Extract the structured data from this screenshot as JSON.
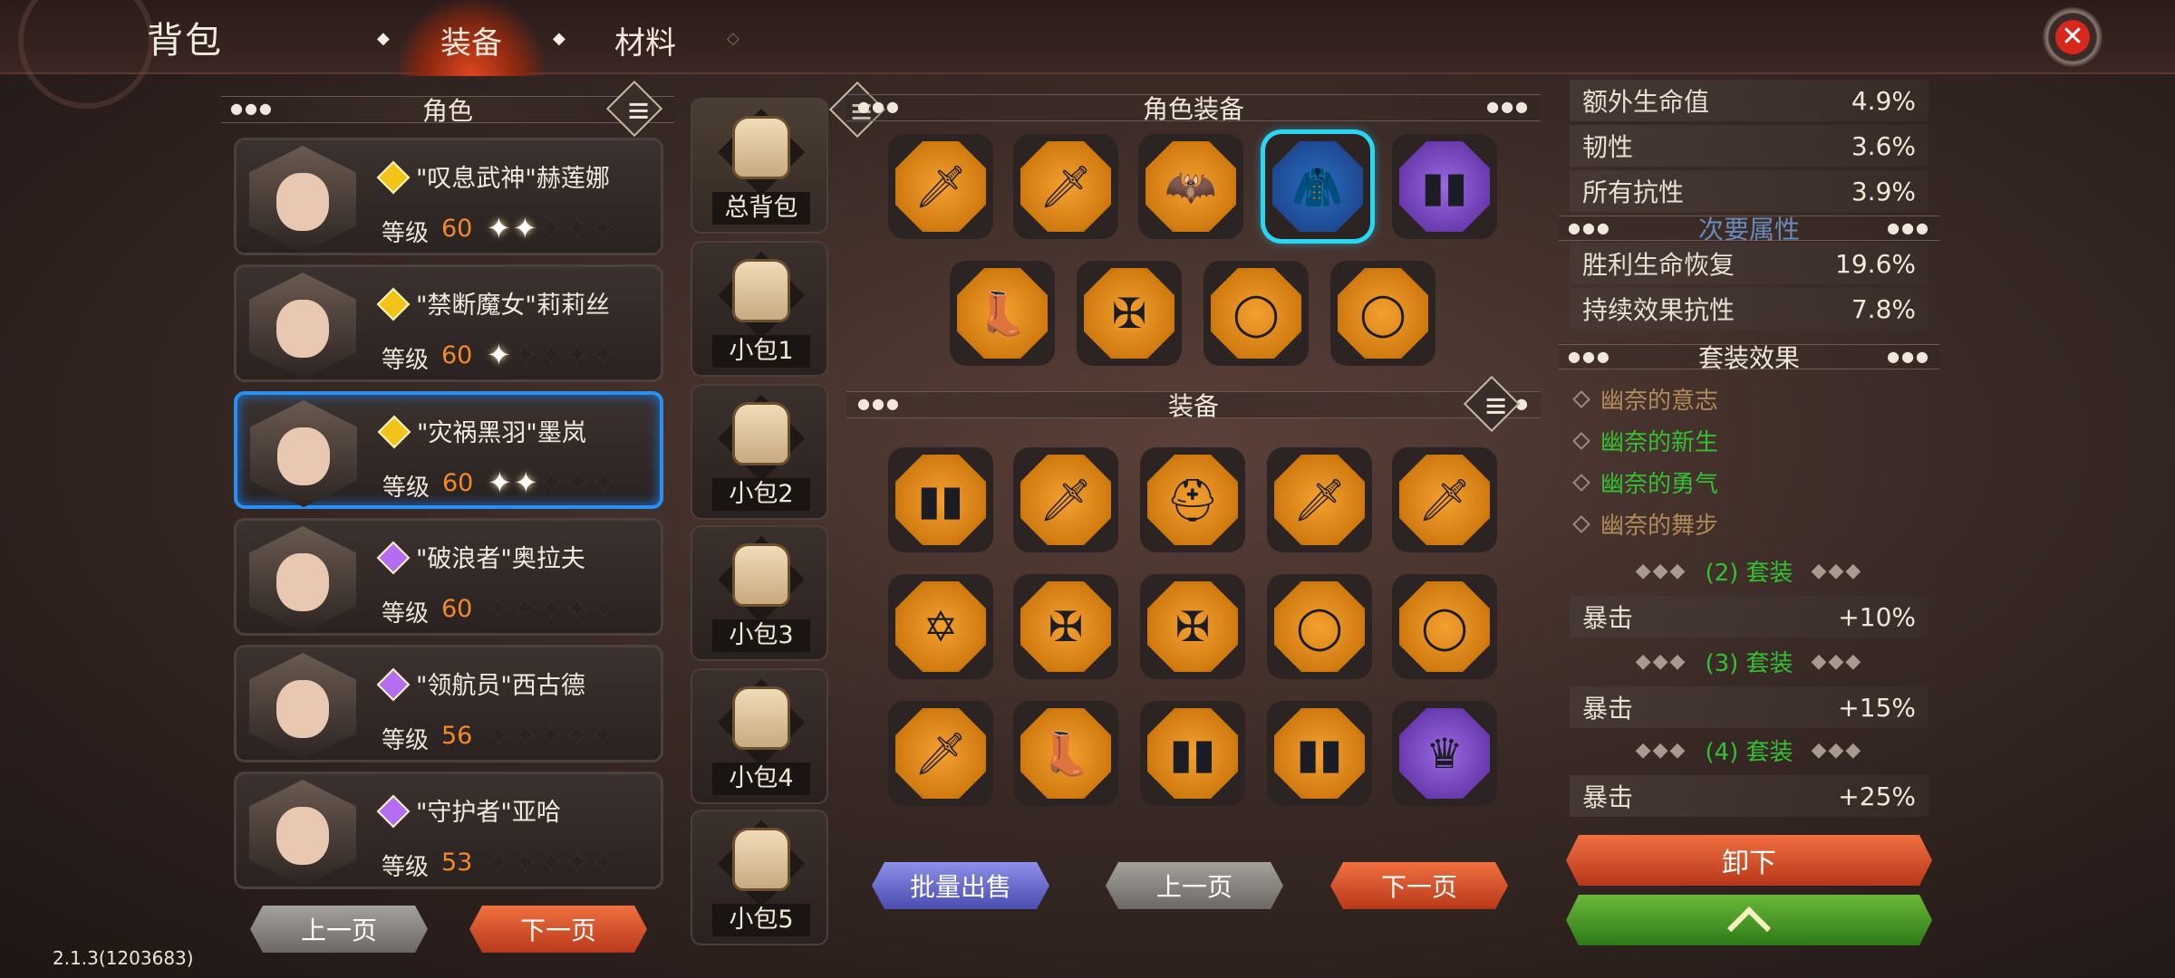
{
  "header": {
    "title": "背包",
    "tabs": [
      {
        "label": "装备",
        "active": true
      },
      {
        "label": "材料",
        "active": false
      }
    ]
  },
  "heroes_section": {
    "title": "角色"
  },
  "heroes": [
    {
      "name": "\"叹息武神\"赫莲娜",
      "level_label": "等级",
      "level": "60",
      "stars": 2,
      "gem_color": "#f2c41a"
    },
    {
      "name": "\"禁断魔女\"莉莉丝",
      "level_label": "等级",
      "level": "60",
      "stars": 1,
      "gem_color": "#f2c41a"
    },
    {
      "name": "\"灾祸黑羽\"墨岚",
      "level_label": "等级",
      "level": "60",
      "stars": 2,
      "gem_color": "#f2c41a",
      "selected": true
    },
    {
      "name": "\"破浪者\"奥拉夫",
      "level_label": "等级",
      "level": "60",
      "stars": 0,
      "gem_color": "#b46cf0"
    },
    {
      "name": "\"领航员\"西古德",
      "level_label": "等级",
      "level": "56",
      "stars": 0,
      "gem_color": "#b46cf0"
    },
    {
      "name": "\"守护者\"亚哈",
      "level_label": "等级",
      "level": "53",
      "stars": 0,
      "gem_color": "#b46cf0"
    }
  ],
  "hero_pager": {
    "prev": "上一页",
    "next": "下一页"
  },
  "bags": [
    {
      "label": "总背包",
      "active": true
    },
    {
      "label": "小包1"
    },
    {
      "label": "小包2"
    },
    {
      "label": "小包3"
    },
    {
      "label": "小包4"
    },
    {
      "label": "小包5"
    }
  ],
  "character_equipment": {
    "title": "角色装备",
    "slots": [
      {
        "icon": "dagger-icon",
        "glyph": "🗡",
        "rarity": "orange"
      },
      {
        "icon": "dagger-icon",
        "glyph": "🗡",
        "rarity": "orange"
      },
      {
        "icon": "mask-icon",
        "glyph": "🦇",
        "rarity": "orange"
      },
      {
        "icon": "cloak-icon",
        "glyph": "🧥",
        "rarity": "blue",
        "highlighted": true
      },
      {
        "icon": "bracers-icon",
        "glyph": "▮▮",
        "rarity": "purple"
      },
      {
        "icon": "boots-icon",
        "glyph": "👢",
        "rarity": "orange"
      },
      {
        "icon": "amulet-icon",
        "glyph": "✠",
        "rarity": "orange"
      },
      {
        "icon": "ring-icon",
        "glyph": "◯",
        "rarity": "orange"
      },
      {
        "icon": "ring-icon",
        "glyph": "◯",
        "rarity": "orange"
      }
    ]
  },
  "inventory": {
    "title": "装备",
    "items": [
      {
        "icon": "bracers-icon",
        "glyph": "▮▮",
        "rarity": "orange"
      },
      {
        "icon": "dagger-icon",
        "glyph": "🗡",
        "rarity": "orange"
      },
      {
        "icon": "hood-icon",
        "glyph": "⛑",
        "rarity": "orange"
      },
      {
        "icon": "dagger-icon",
        "glyph": "🗡",
        "rarity": "orange"
      },
      {
        "icon": "dagger-icon",
        "glyph": "🗡",
        "rarity": "orange"
      },
      {
        "icon": "hexagram-amulet-icon",
        "glyph": "✡",
        "rarity": "orange"
      },
      {
        "icon": "amulet-icon",
        "glyph": "✠",
        "rarity": "orange"
      },
      {
        "icon": "amulet-icon",
        "glyph": "✠",
        "rarity": "orange"
      },
      {
        "icon": "ring-icon",
        "glyph": "◯",
        "rarity": "orange"
      },
      {
        "icon": "ring-icon",
        "glyph": "◯",
        "rarity": "orange"
      },
      {
        "icon": "dagger-icon",
        "glyph": "🗡",
        "rarity": "orange"
      },
      {
        "icon": "boots-icon",
        "glyph": "👢",
        "rarity": "orange"
      },
      {
        "icon": "bracers-icon",
        "glyph": "▮▮",
        "rarity": "orange"
      },
      {
        "icon": "bracers-icon",
        "glyph": "▮▮",
        "rarity": "orange"
      },
      {
        "icon": "helmet-icon",
        "glyph": "♛",
        "rarity": "purple"
      }
    ],
    "bulk_sell": "批量出售",
    "prev": "上一页",
    "next": "下一页"
  },
  "stats": {
    "primary": [
      {
        "label": "额外生命值",
        "value": "4.9%"
      },
      {
        "label": "韧性",
        "value": "3.6%"
      },
      {
        "label": "所有抗性",
        "value": "3.9%"
      }
    ],
    "secondary_title": "次要属性",
    "secondary": [
      {
        "label": "胜利生命恢复",
        "value": "19.6%"
      },
      {
        "label": "持续效果抗性",
        "value": "7.8%"
      }
    ],
    "set_title": "套装效果",
    "set_pieces": [
      {
        "label": "幽奈的意志",
        "active": false
      },
      {
        "label": "幽奈的新生",
        "active": true
      },
      {
        "label": "幽奈的勇气",
        "active": true
      },
      {
        "label": "幽奈的舞步",
        "active": false
      }
    ],
    "set_bonuses": [
      {
        "note": "(2) 套装",
        "label": "暴击",
        "value": "+10%"
      },
      {
        "note": "(3) 套装",
        "label": "暴击",
        "value": "+15%"
      },
      {
        "note": "(4) 套装",
        "label": "暴击",
        "value": "+25%"
      }
    ],
    "set_deco": "◆◆◆",
    "unequip": "卸下"
  },
  "colors": {
    "accent_orange": "#f28a2a",
    "set_active_green": "#34c034",
    "set_inactive_gold": "#b08a5a",
    "selection_blue": "#2a8ff0",
    "highlight_cyan": "#29d6f4"
  },
  "version": "2.1.3(1203683)"
}
